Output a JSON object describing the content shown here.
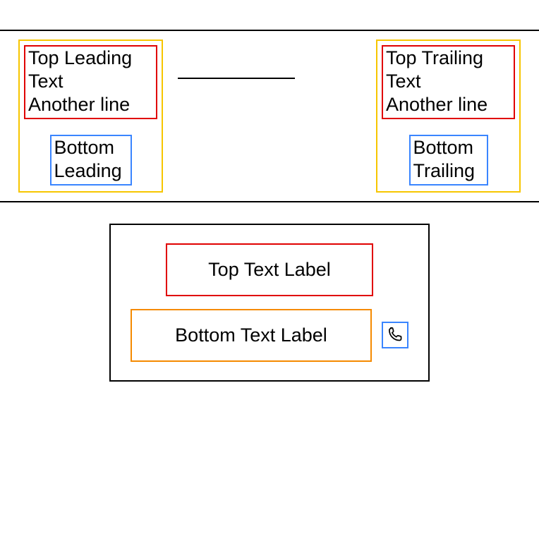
{
  "row": {
    "leading": {
      "top_line1": "Top Leading",
      "top_line2": "Text",
      "top_line3": "Another line",
      "bottom_line1": "Bottom",
      "bottom_line2": "Leading"
    },
    "trailing": {
      "top_line1": "Top Trailing",
      "top_line2": "Text",
      "top_line3": "Another line",
      "bottom_line1": "Bottom",
      "bottom_line2": "Trailing"
    }
  },
  "bottom": {
    "top_label": "Top Text Label",
    "bottom_label": "Bottom Text Label",
    "icon_name": "phone-icon"
  },
  "colors": {
    "yellow_border": "#f7c600",
    "red_border": "#e00000",
    "blue_border": "#3a85ff",
    "orange_border": "#f58a00",
    "black": "#000000"
  }
}
